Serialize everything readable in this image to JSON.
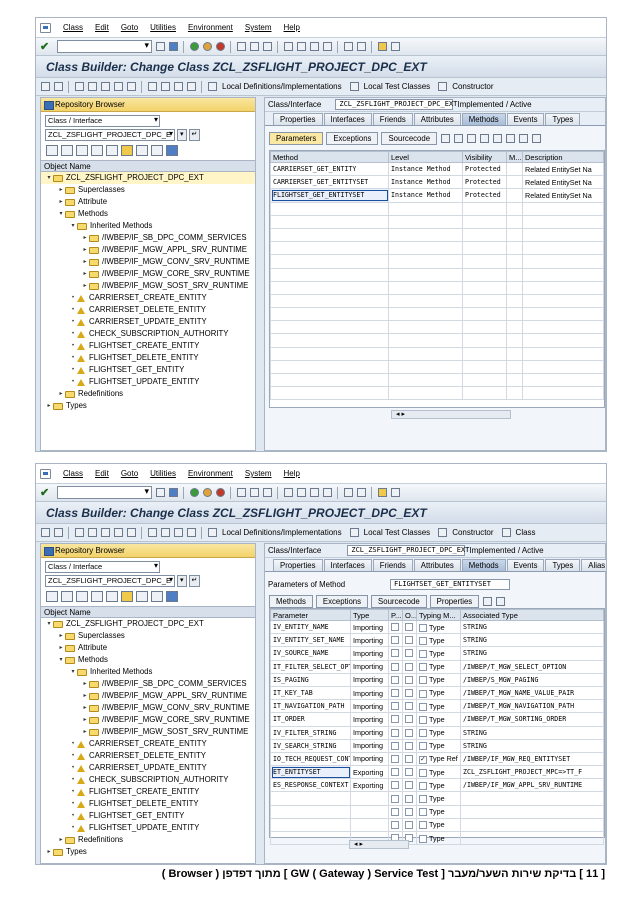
{
  "menu": [
    "Class",
    "Edit",
    "Goto",
    "Utilities",
    "Environment",
    "System",
    "Help"
  ],
  "title": "Class Builder: Change Class ZCL_ZSFLIGHT_PROJECT_DPC_EXT",
  "appbar": {
    "local_defs": "Local Definitions/Implementations",
    "local_test": "Local Test Classes",
    "constructor": "Constructor",
    "class_ctor": "Class"
  },
  "repo": {
    "header": "Repository Browser",
    "type": "Class / Interface",
    "name": "ZCL_ZSFLIGHT_PROJECT_DPC_E",
    "tree_header": "Object Name",
    "tree": [
      {
        "label": "ZCL_ZSFLIGHT_PROJECT_DPC_EXT",
        "level": 0,
        "icon": "folder",
        "tw": "▾"
      },
      {
        "label": "Superclasses",
        "level": 1,
        "icon": "folder",
        "tw": "▸"
      },
      {
        "label": "Attribute",
        "level": 1,
        "icon": "folder",
        "tw": "▸"
      },
      {
        "label": "Methods",
        "level": 1,
        "icon": "folder",
        "tw": "▾"
      },
      {
        "label": "Inherited Methods",
        "level": 2,
        "icon": "folder",
        "tw": "▾"
      },
      {
        "label": "/IWBEP/IF_SB_DPC_COMM_SERVICES",
        "level": 3,
        "icon": "folder",
        "tw": "▸"
      },
      {
        "label": "/IWBEP/IF_MGW_APPL_SRV_RUNTIME",
        "level": 3,
        "icon": "folder",
        "tw": "▸"
      },
      {
        "label": "/IWBEP/IF_MGW_CONV_SRV_RUNTIME",
        "level": 3,
        "icon": "folder",
        "tw": "▸"
      },
      {
        "label": "/IWBEP/IF_MGW_CORE_SRV_RUNTIME",
        "level": 3,
        "icon": "folder",
        "tw": "▸"
      },
      {
        "label": "/IWBEP/IF_MGW_SOST_SRV_RUNTIME",
        "level": 3,
        "icon": "folder",
        "tw": "▸"
      },
      {
        "label": "CARRIERSET_CREATE_ENTITY",
        "level": 2,
        "icon": "method",
        "tw": "•"
      },
      {
        "label": "CARRIERSET_DELETE_ENTITY",
        "level": 2,
        "icon": "method",
        "tw": "•"
      },
      {
        "label": "CARRIERSET_UPDATE_ENTITY",
        "level": 2,
        "icon": "method",
        "tw": "•"
      },
      {
        "label": "CHECK_SUBSCRIPTION_AUTHORITY",
        "level": 2,
        "icon": "method",
        "tw": "•"
      },
      {
        "label": "FLIGHTSET_CREATE_ENTITY",
        "level": 2,
        "icon": "method",
        "tw": "•"
      },
      {
        "label": "FLIGHTSET_DELETE_ENTITY",
        "level": 2,
        "icon": "method",
        "tw": "•"
      },
      {
        "label": "FLIGHTSET_GET_ENTITY",
        "level": 2,
        "icon": "method",
        "tw": "•"
      },
      {
        "label": "FLIGHTSET_UPDATE_ENTITY",
        "level": 2,
        "icon": "method",
        "tw": "•"
      },
      {
        "label": "Redefinitions",
        "level": 1,
        "icon": "folder",
        "tw": "▸"
      },
      {
        "label": "Types",
        "level": 0,
        "icon": "folder",
        "tw": "▸"
      }
    ]
  },
  "class_row": {
    "label": "Class/Interface",
    "value": "ZCL_ZSFLIGHT_PROJECT_DPC_EXT",
    "status": "Implemented / Active"
  },
  "tabs1": [
    "Properties",
    "Interfaces",
    "Friends",
    "Attributes",
    "Methods",
    "Events",
    "Types"
  ],
  "tabs2": [
    "Properties",
    "Interfaces",
    "Friends",
    "Attributes",
    "Methods",
    "Events",
    "Types",
    "Alias"
  ],
  "methods_toolbar": {
    "parameters": "Parameters",
    "exceptions": "Exceptions",
    "sourcecode": "Sourcecode"
  },
  "methods_table": {
    "columns": [
      "Method",
      "Level",
      "Visibility",
      "M...",
      "Description"
    ],
    "rows": [
      [
        "CARRIERSET_GET_ENTITY",
        "Instance Method",
        "Protected",
        "",
        "Related EntitySet Na"
      ],
      [
        "CARRIERSET_GET_ENTITYSET",
        "Instance Method",
        "Protected",
        "",
        "Related EntitySet Na"
      ],
      [
        "FLIGHTSET_GET_ENTITYSET",
        "Instance Method",
        "Protected",
        "",
        "Related EntitySet Na"
      ]
    ]
  },
  "params": {
    "label": "Parameters of Method",
    "method": "FLIGHTSET_GET_ENTITYSET",
    "toolbar": {
      "methods": "Methods",
      "exceptions": "Exceptions",
      "sourcecode": "Sourcecode",
      "properties": "Properties"
    },
    "columns": [
      "Parameter",
      "Type",
      "P...",
      "O...",
      "Typing M...",
      "Associated Type"
    ],
    "rows": [
      [
        "IV_ENTITY_NAME",
        "Importing",
        "Type",
        "STRING"
      ],
      [
        "IV_ENTITY_SET_NAME",
        "Importing",
        "Type",
        "STRING"
      ],
      [
        "IV_SOURCE_NAME",
        "Importing",
        "Type",
        "STRING"
      ],
      [
        "IT_FILTER_SELECT_OPTIONS",
        "Importing",
        "Type",
        "/IWBEP/T_MGW_SELECT_OPTION"
      ],
      [
        "IS_PAGING",
        "Importing",
        "Type",
        "/IWBEP/S_MGW_PAGING"
      ],
      [
        "IT_KEY_TAB",
        "Importing",
        "Type",
        "/IWBEP/T_MGW_NAME_VALUE_PAIR"
      ],
      [
        "IT_NAVIGATION_PATH",
        "Importing",
        "Type",
        "/IWBEP/T_MGW_NAVIGATION_PATH"
      ],
      [
        "IT_ORDER",
        "Importing",
        "Type",
        "/IWBEP/T_MGW_SORTING_ORDER"
      ],
      [
        "IV_FILTER_STRING",
        "Importing",
        "Type",
        "STRING"
      ],
      [
        "IV_SEARCH_STRING",
        "Importing",
        "Type",
        "STRING"
      ],
      [
        "IO_TECH_REQUEST_CONTEXT",
        "Importing",
        "Type Ref",
        "/IWBEP/IF_MGW_REQ_ENTITYSET"
      ],
      [
        "ET_ENTITYSET",
        "Exporting",
        "Type",
        "ZCL_ZSFLIGHT_PROJECT_MPC=>TT_F"
      ],
      [
        "ES_RESPONSE_CONTEXT",
        "Exporting",
        "Type",
        "/IWBEP/IF_MGW_APPL_SRV_RUNTIME"
      ],
      [
        "",
        "",
        "Type",
        ""
      ],
      [
        "",
        "",
        "Type",
        ""
      ],
      [
        "",
        "",
        "Type",
        ""
      ],
      [
        "",
        "",
        "Type",
        ""
      ]
    ]
  },
  "caption": "[ 11 ] בדיקת שירות השער/מעבר [ GW ( Gateway ) Service Test ] מתוך דפדפן ( Browser )"
}
